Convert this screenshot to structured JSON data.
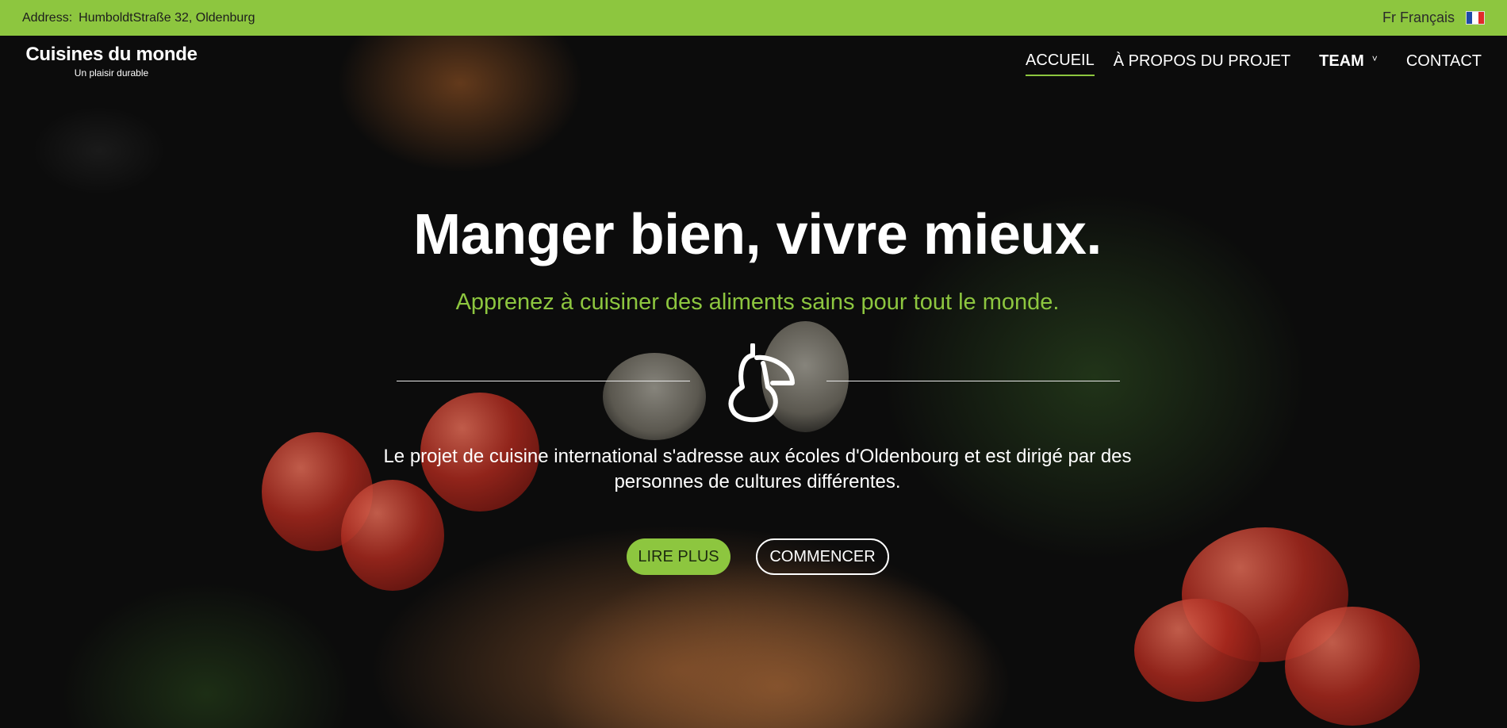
{
  "topbar": {
    "address_label": "Address:",
    "address_value": "HumboldtStraße 32, Oldenburg",
    "language_code": "Fr",
    "language_name": "Français",
    "flag_colors": [
      "#1e4aa8",
      "#ffffff",
      "#e12a2a"
    ]
  },
  "brand": {
    "name": "Cuisines du monde",
    "tagline": "Un plaisir durable"
  },
  "nav": {
    "home": "ACCUEIL",
    "about": "À PROPOS DU PROJET",
    "team": "TEAM",
    "team_chevron": "˅",
    "contact": "CONTACT"
  },
  "hero": {
    "title": "Manger bien, vivre mieux.",
    "subtitle": "Apprenez à cuisiner des aliments sains pour tout le monde.",
    "icon": "pear-icon",
    "description": "Le projet de cuisine international s'adresse aux écoles d'Oldenbourg et est dirigé par des personnes de cultures différentes.",
    "primary_button": "LIRE PLUS",
    "secondary_button": "COMMENCER"
  },
  "colors": {
    "accent": "#8dc63f",
    "text": "#ffffff",
    "background": "#0c0c0c"
  }
}
